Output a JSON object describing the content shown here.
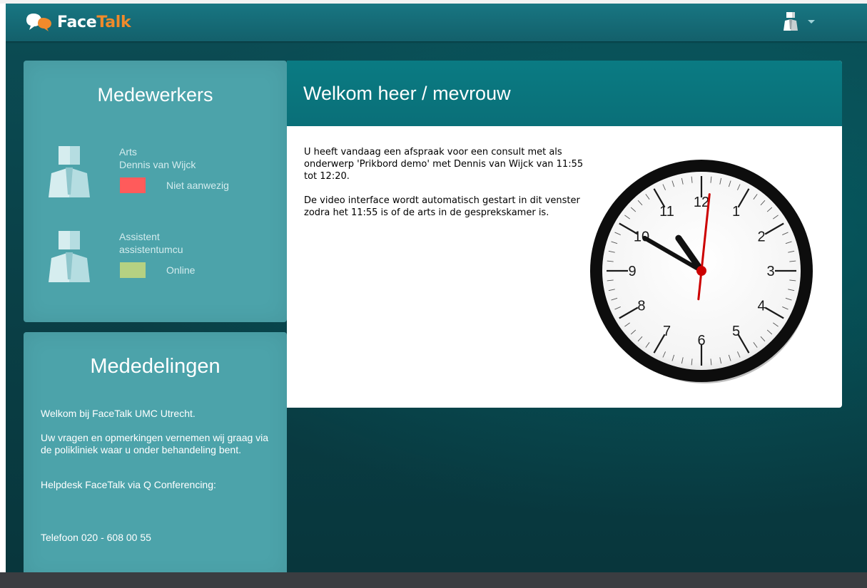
{
  "app": {
    "logo_face": "Face",
    "logo_talk": "Talk"
  },
  "staff_panel": {
    "title": "Medewerkers",
    "members": [
      {
        "role": "Arts",
        "name": "Dennis van Wijck",
        "status": "Niet aanwezig",
        "status_color": "#ff5b5b"
      },
      {
        "role": "Assistent",
        "name": "assistentumcu",
        "status": "Online",
        "status_color": "#b5d182"
      }
    ]
  },
  "notices_panel": {
    "title": "Mededelingen",
    "lines": [
      "Welkom bij FaceTalk UMC Utrecht.",
      "Uw vragen en opmerkingen vernemen wij graag via de polikliniek waar u onder behandeling bent.",
      "Helpdesk FaceTalk via Q Conferencing:",
      "Telefoon  020 - 608 00 55"
    ]
  },
  "welcome": {
    "title": "Welkom heer / mevrouw",
    "paragraph1": "U heeft vandaag een afspraak voor een consult met als onderwerp 'Prikbord demo' met Dennis van Wijck van 11:55 tot 12:20.",
    "paragraph2": "De video interface wordt automatisch gestart in dit venster zodra het 11:55 is of de arts in de gesprekskamer is."
  },
  "clock": {
    "numerals": [
      "12",
      "1",
      "2",
      "3",
      "4",
      "5",
      "6",
      "7",
      "8",
      "9",
      "10",
      "11"
    ],
    "hour": 10,
    "minute": 50,
    "second": 1
  },
  "colors": {
    "accent_orange": "#f08a2b",
    "header_teal": "#187682",
    "panel_teal": "#4ca3aa",
    "second_hand": "#cc0000"
  },
  "icons": {
    "logo": "speech-bubbles-icon",
    "user": "user-icon",
    "dropdown": "chevron-down-icon",
    "avatar": "person-silhouette-icon"
  }
}
